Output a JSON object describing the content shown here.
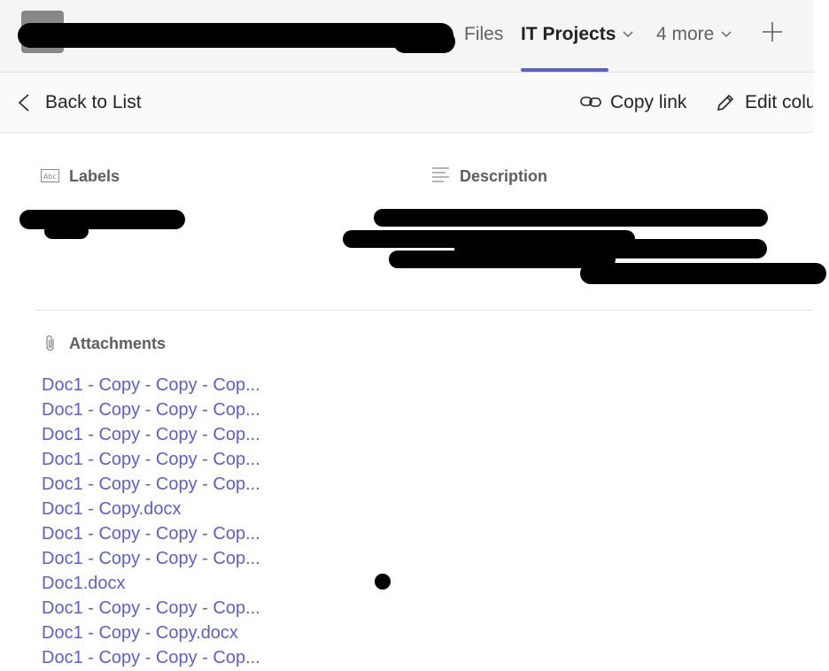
{
  "header": {
    "tabs": [
      {
        "label": "Files"
      },
      {
        "label": "IT Projects"
      },
      {
        "label": "4 more"
      }
    ]
  },
  "toolbar": {
    "back_label": "Back to List",
    "copy_link_label": "Copy link",
    "edit_label": "Edit colu"
  },
  "fields": {
    "labels_title": "Labels",
    "description_title": "Description",
    "attachments_title": "Attachments"
  },
  "attachments": [
    "Doc1 - Copy - Copy - Cop...",
    "Doc1 - Copy - Copy - Cop...",
    "Doc1 - Copy - Copy - Cop...",
    "Doc1 - Copy - Copy - Cop...",
    "Doc1 - Copy - Copy - Cop...",
    "Doc1 - Copy.docx",
    "Doc1 - Copy - Copy - Cop...",
    "Doc1 - Copy - Copy - Cop...",
    "Doc1.docx",
    "Doc1 - Copy - Copy - Cop...",
    "Doc1 - Copy - Copy.docx",
    "Doc1 - Copy - Copy - Cop..."
  ],
  "colors": {
    "accent": "#5b5fc7",
    "link": "#5b5fc7"
  }
}
